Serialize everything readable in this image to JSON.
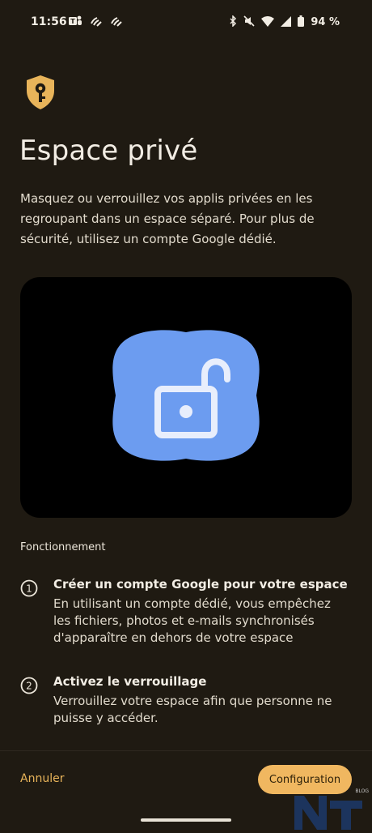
{
  "status_bar": {
    "time": "11:56",
    "battery": "94 %",
    "left_icons": [
      "teams-icon",
      "wifi-calling-icon",
      "wifi-calling-icon"
    ],
    "right_icons": [
      "bluetooth-icon",
      "mute-icon",
      "wifi-icon",
      "signal-icon",
      "battery-icon"
    ]
  },
  "header": {
    "icon": "shield-key-icon",
    "title": "Espace privé",
    "description": "Masquez ou verrouillez vos applis privées en les regroupant dans un espace séparé. Pour plus de sécurité, utilisez un compte Google dédié."
  },
  "illustration": {
    "icon": "unlocked-padlock-icon",
    "colors": {
      "background": "#000000",
      "blob": "#6c9cf0",
      "lock": "#e8eefc"
    }
  },
  "how_it_works": {
    "label": "Fonctionnement",
    "steps": [
      {
        "number": "1",
        "title": "Créer un compte Google pour votre espace",
        "body": "En utilisant un compte dédié, vous empêchez les fichiers, photos et e-mails synchronisés d'apparaître en dehors de votre espace"
      },
      {
        "number": "2",
        "title": "Activez le verrouillage",
        "body": "Verrouillez votre espace afin que personne ne puisse y accéder."
      }
    ]
  },
  "footer": {
    "cancel_label": "Annuler",
    "config_label": "Configuration"
  },
  "watermark": {
    "text": "BLOG"
  },
  "theme": {
    "background": "#1f1a12",
    "accent": "#f0b760",
    "text": "#ece6da"
  }
}
